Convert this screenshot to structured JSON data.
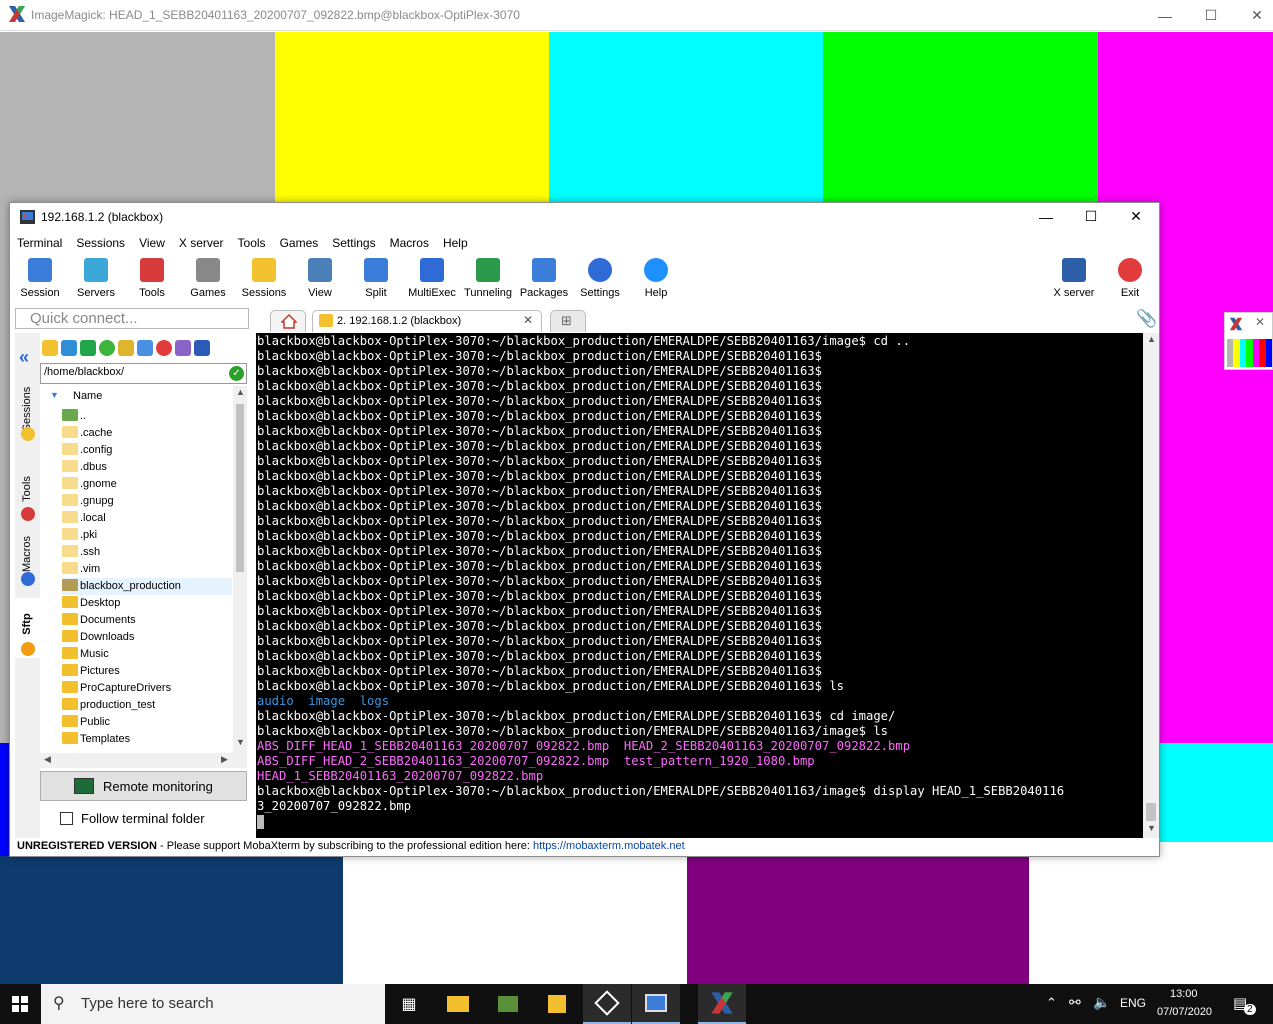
{
  "imagemagick": {
    "title": "ImageMagick: HEAD_1_SEBB20401163_20200707_092822.bmp@blackbox-OptiPlex-3070",
    "bars_top": [
      "#b4b4b4",
      "#ffff00",
      "#00ffff",
      "#00ff00",
      "#ff00ff"
    ],
    "bars_bottom": [
      "#0d3b6e",
      "#ffffff",
      "#800080",
      "#ffffff"
    ]
  },
  "moba": {
    "title": "192.168.1.2 (blackbox)",
    "menu": [
      "Terminal",
      "Sessions",
      "View",
      "X server",
      "Tools",
      "Games",
      "Settings",
      "Macros",
      "Help"
    ],
    "toolbar": [
      "Session",
      "Servers",
      "Tools",
      "Games",
      "Sessions",
      "View",
      "Split",
      "MultiExec",
      "Tunneling",
      "Packages",
      "Settings",
      "Help"
    ],
    "toolbar_right": [
      "X server",
      "Exit"
    ],
    "quick_connect": "Quick connect...",
    "tab_label": "2. 192.168.1.2 (blackbox)",
    "side_tabs": [
      "Sessions",
      "Tools",
      "Macros",
      "Sftp"
    ],
    "sftp": {
      "path": "/home/blackbox/",
      "column": "Name",
      "items": [
        "..",
        ".cache",
        ".config",
        ".dbus",
        ".gnome",
        ".gnupg",
        ".local",
        ".pki",
        ".ssh",
        ".vim",
        "blackbox_production",
        "Desktop",
        "Documents",
        "Downloads",
        "Music",
        "Pictures",
        "ProCaptureDrivers",
        "production_test",
        "Public",
        "Templates"
      ],
      "remote_monitoring": "Remote monitoring",
      "follow_terminal": "Follow terminal folder"
    },
    "terminal": {
      "lines": [
        "blackbox@blackbox-OptiPlex-3070:~/blackbox_production/EMERALDPE/SEBB20401163/image$ cd ..",
        "blackbox@blackbox-OptiPlex-3070:~/blackbox_production/EMERALDPE/SEBB20401163$",
        "blackbox@blackbox-OptiPlex-3070:~/blackbox_production/EMERALDPE/SEBB20401163$",
        "blackbox@blackbox-OptiPlex-3070:~/blackbox_production/EMERALDPE/SEBB20401163$",
        "blackbox@blackbox-OptiPlex-3070:~/blackbox_production/EMERALDPE/SEBB20401163$",
        "blackbox@blackbox-OptiPlex-3070:~/blackbox_production/EMERALDPE/SEBB20401163$",
        "blackbox@blackbox-OptiPlex-3070:~/blackbox_production/EMERALDPE/SEBB20401163$",
        "blackbox@blackbox-OptiPlex-3070:~/blackbox_production/EMERALDPE/SEBB20401163$",
        "blackbox@blackbox-OptiPlex-3070:~/blackbox_production/EMERALDPE/SEBB20401163$",
        "blackbox@blackbox-OptiPlex-3070:~/blackbox_production/EMERALDPE/SEBB20401163$",
        "blackbox@blackbox-OptiPlex-3070:~/blackbox_production/EMERALDPE/SEBB20401163$",
        "blackbox@blackbox-OptiPlex-3070:~/blackbox_production/EMERALDPE/SEBB20401163$",
        "blackbox@blackbox-OptiPlex-3070:~/blackbox_production/EMERALDPE/SEBB20401163$",
        "blackbox@blackbox-OptiPlex-3070:~/blackbox_production/EMERALDPE/SEBB20401163$",
        "blackbox@blackbox-OptiPlex-3070:~/blackbox_production/EMERALDPE/SEBB20401163$",
        "blackbox@blackbox-OptiPlex-3070:~/blackbox_production/EMERALDPE/SEBB20401163$",
        "blackbox@blackbox-OptiPlex-3070:~/blackbox_production/EMERALDPE/SEBB20401163$",
        "blackbox@blackbox-OptiPlex-3070:~/blackbox_production/EMERALDPE/SEBB20401163$",
        "blackbox@blackbox-OptiPlex-3070:~/blackbox_production/EMERALDPE/SEBB20401163$",
        "blackbox@blackbox-OptiPlex-3070:~/blackbox_production/EMERALDPE/SEBB20401163$",
        "blackbox@blackbox-OptiPlex-3070:~/blackbox_production/EMERALDPE/SEBB20401163$",
        "blackbox@blackbox-OptiPlex-3070:~/blackbox_production/EMERALDPE/SEBB20401163$",
        "blackbox@blackbox-OptiPlex-3070:~/blackbox_production/EMERALDPE/SEBB20401163$",
        "blackbox@blackbox-OptiPlex-3070:~/blackbox_production/EMERALDPE/SEBB20401163$ ls",
        "audio  image  logs",
        "blackbox@blackbox-OptiPlex-3070:~/blackbox_production/EMERALDPE/SEBB20401163$ cd image/",
        "blackbox@blackbox-OptiPlex-3070:~/blackbox_production/EMERALDPE/SEBB20401163/image$ ls",
        "ABS_DIFF_HEAD_1_SEBB20401163_20200707_092822.bmp  HEAD_2_SEBB20401163_20200707_092822.bmp",
        "ABS_DIFF_HEAD_2_SEBB20401163_20200707_092822.bmp  test_pattern_1920_1080.bmp",
        "HEAD_1_SEBB20401163_20200707_092822.bmp",
        "blackbox@blackbox-OptiPlex-3070:~/blackbox_production/EMERALDPE/SEBB20401163/image$ display HEAD_1_SEBB2040116",
        "3_20200707_092822.bmp"
      ],
      "dir_color": "#3a96dd",
      "file_color": "#ff69ff"
    },
    "status": {
      "label": "UNREGISTERED VERSION",
      "text": "  -  Please support MobaXterm by subscribing to the professional edition here:  ",
      "link": "https://mobaxterm.mobatek.net"
    }
  },
  "taskbar": {
    "search_placeholder": "Type here to search",
    "lang": "ENG",
    "time": "13:00",
    "date": "07/07/2020",
    "notifications": "2"
  }
}
